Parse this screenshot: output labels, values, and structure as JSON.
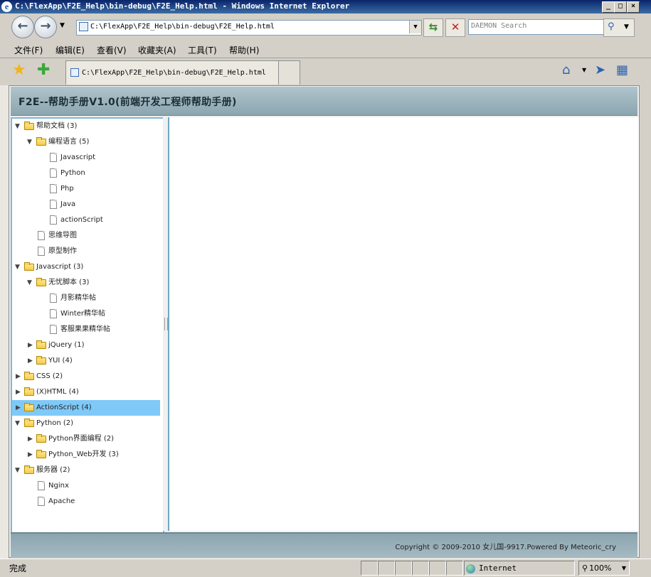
{
  "window": {
    "title": "C:\\FlexApp\\F2E_Help\\bin-debug\\F2E_Help.html - Windows Internet Explorer",
    "controls": [
      "_",
      "□",
      "×"
    ]
  },
  "toolbar": {
    "back_glyph": "←",
    "forward_glyph": "→",
    "address": "C:\\FlexApp\\F2E_Help\\bin-debug\\F2E_Help.html",
    "search_placeholder": "DAEMON Search"
  },
  "menu": {
    "items": [
      "文件(F)",
      "编辑(E)",
      "查看(V)",
      "收藏夹(A)",
      "工具(T)",
      "帮助(H)"
    ]
  },
  "tabs": {
    "active_label": "C:\\FlexApp\\F2E_Help\\bin-debug\\F2E_Help.html"
  },
  "icons": {
    "favorites": "star-icon",
    "add_favorite": "add-favorite-icon",
    "home": "home-icon",
    "feeds": "feeds-icon",
    "tools": "tools-icon",
    "refresh": "refresh-icon",
    "stop": "stop-icon",
    "search": "search-icon"
  },
  "app": {
    "header_title": "F2E--帮助手册V1.0(前端开发工程师帮助手册)",
    "footer_copyright": "Copyright © 2009-2010 女儿国-9917.Powered By Meteoric_cry"
  },
  "tree": {
    "selected_label": "ActionScript (4)",
    "selected_color": "#7fc9f8",
    "nodes": [
      {
        "label": "帮助文档 (3)",
        "type": "folder",
        "state": "expanded"
      },
      {
        "label": "编程语言 (5)",
        "type": "folder",
        "state": "expanded"
      },
      {
        "label": "Javascript",
        "type": "file"
      },
      {
        "label": "Python",
        "type": "file"
      },
      {
        "label": "Php",
        "type": "file"
      },
      {
        "label": "Java",
        "type": "file"
      },
      {
        "label": "actionScript",
        "type": "file"
      },
      {
        "label": "思维导图",
        "type": "file"
      },
      {
        "label": "原型制作",
        "type": "file"
      },
      {
        "label": "Javascript (3)",
        "type": "folder",
        "state": "expanded"
      },
      {
        "label": "无忧脚本 (3)",
        "type": "folder",
        "state": "expanded"
      },
      {
        "label": "月影精华帖",
        "type": "file"
      },
      {
        "label": "Winter精华帖",
        "type": "file"
      },
      {
        "label": "客服果果精华帖",
        "type": "file"
      },
      {
        "label": "jQuery (1)",
        "type": "folder",
        "state": "collapsed"
      },
      {
        "label": "YUI (4)",
        "type": "folder",
        "state": "collapsed"
      },
      {
        "label": "CSS (2)",
        "type": "folder",
        "state": "collapsed"
      },
      {
        "label": "(X)HTML (4)",
        "type": "folder",
        "state": "collapsed"
      },
      {
        "label": "ActionScript (4)",
        "type": "folder",
        "state": "collapsed",
        "selected": true
      },
      {
        "label": "Python (2)",
        "type": "folder",
        "state": "expanded"
      },
      {
        "label": "Python界面编程 (2)",
        "type": "folder",
        "state": "collapsed"
      },
      {
        "label": "Python_Web开发 (3)",
        "type": "folder",
        "state": "collapsed"
      },
      {
        "label": "服务器 (2)",
        "type": "folder",
        "state": "expanded"
      },
      {
        "label": "Nginx",
        "type": "file"
      },
      {
        "label": "Apache",
        "type": "file"
      }
    ]
  },
  "status": {
    "text": "完成",
    "zone": "Internet",
    "zoom": "100%"
  }
}
